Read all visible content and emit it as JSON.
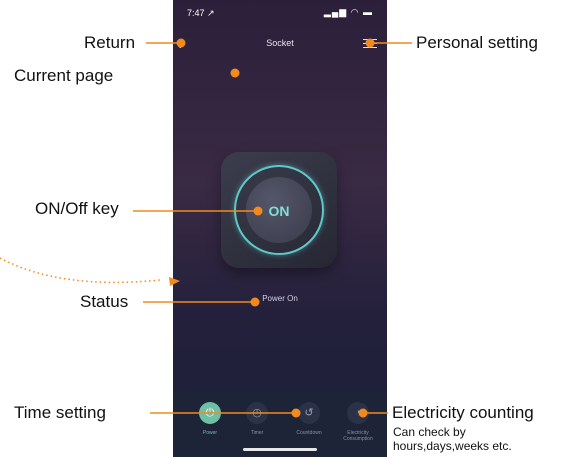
{
  "status_bar": {
    "time": "7:47 ↗",
    "signal": "▂▄▆ ◠ ▬"
  },
  "nav": {
    "title": "Socket"
  },
  "power_key": {
    "label": "ON",
    "ring_color": "#5fc8c8"
  },
  "status": {
    "text": "Power On"
  },
  "tabs": [
    {
      "label": "Power",
      "icon": "power-icon",
      "glyph": "⏻",
      "active": true
    },
    {
      "label": "Timer",
      "icon": "timer-icon",
      "glyph": "◷",
      "active": false
    },
    {
      "label": "Countdown",
      "icon": "countdown-icon",
      "glyph": "↺",
      "active": false
    },
    {
      "label": "Electricity Consumption",
      "icon": "electricity-icon",
      "glyph": "◔",
      "active": false
    }
  ],
  "annotations": {
    "return": "Return",
    "current_page": "Current page",
    "personal_setting": "Personal setting",
    "on_off_key": "ON/Off key",
    "status": "Status",
    "time_setting": "Time setting",
    "electricity_counting": "Electricity counting",
    "electricity_note_line1": "Can check by",
    "electricity_note_line2": "hours,days,weeks etc."
  },
  "colors": {
    "accent": "#f28a1e",
    "active_tab": "#6fbfa6"
  }
}
